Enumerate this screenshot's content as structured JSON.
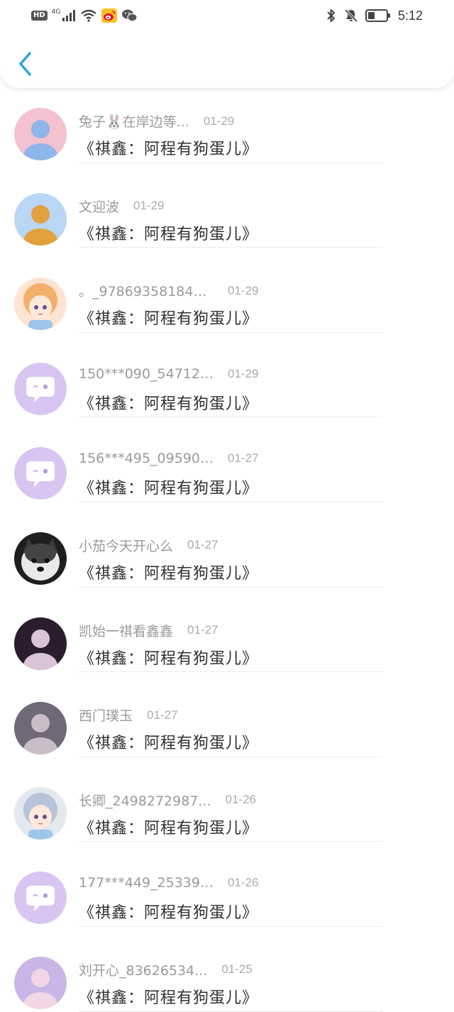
{
  "status_bar": {
    "hd": "HD",
    "network": "4G",
    "time": "5:12"
  },
  "colors": {
    "accent": "#2aa4e0",
    "placeholder_avatar": "#d8c5f2"
  },
  "icons": {
    "back": "chevron-left-icon"
  },
  "items": [
    {
      "name": "兔子🐰在岸边等...",
      "date": "01-29",
      "title": "《祺鑫：阿程有狗蛋儿》",
      "avatar": "photo"
    },
    {
      "name": "文迎波",
      "date": "01-29",
      "title": "《祺鑫：阿程有狗蛋儿》",
      "avatar": "photo"
    },
    {
      "name": "。_978693581840...",
      "date": "01-29",
      "title": "《祺鑫：阿程有狗蛋儿》",
      "avatar": "anime"
    },
    {
      "name": "150***090_547126...",
      "date": "01-29",
      "title": "《祺鑫：阿程有狗蛋儿》",
      "avatar": "default"
    },
    {
      "name": "156***495_095904...",
      "date": "01-27",
      "title": "《祺鑫：阿程有狗蛋儿》",
      "avatar": "default"
    },
    {
      "name": "小茄今天开心么",
      "date": "01-27",
      "title": "《祺鑫：阿程有狗蛋儿》",
      "avatar": "dog"
    },
    {
      "name": "凯始一祺看鑫鑫",
      "date": "01-27",
      "title": "《祺鑫：阿程有狗蛋儿》",
      "avatar": "photo"
    },
    {
      "name": "西门璞玉",
      "date": "01-27",
      "title": "《祺鑫：阿程有狗蛋儿》",
      "avatar": "photo"
    },
    {
      "name": "长卿_2498272987...",
      "date": "01-26",
      "title": "《祺鑫：阿程有狗蛋儿》",
      "avatar": "anime"
    },
    {
      "name": "177***449_253394...",
      "date": "01-26",
      "title": "《祺鑫：阿程有狗蛋儿》",
      "avatar": "default"
    },
    {
      "name": "刘开心_83626534...",
      "date": "01-25",
      "title": "《祺鑫：阿程有狗蛋儿》",
      "avatar": "photo"
    }
  ]
}
